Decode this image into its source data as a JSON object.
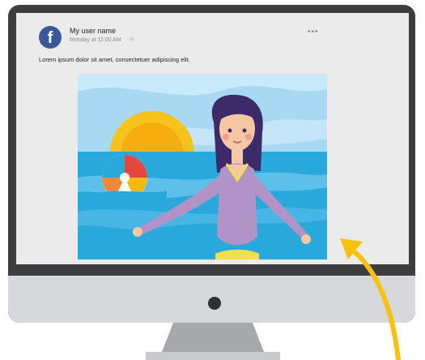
{
  "post": {
    "username": "My user name",
    "timestamp": "Monday at 11:00 AM",
    "globe_icon": "globe-icon",
    "more_label": "•••",
    "text": "Lorem ipsum dolor sit amet, consectetuer adipiscing elit."
  },
  "logo": {
    "letter": "f",
    "color": "#3b5998"
  },
  "colors": {
    "sky": "#a9d9f2",
    "sea": "#29a8dc",
    "sun": "#f5b914",
    "arrow": "#f9c10d",
    "bezel": "#3d3d3f",
    "screen": "#ebebeb",
    "chin": "#d7d8dc"
  }
}
